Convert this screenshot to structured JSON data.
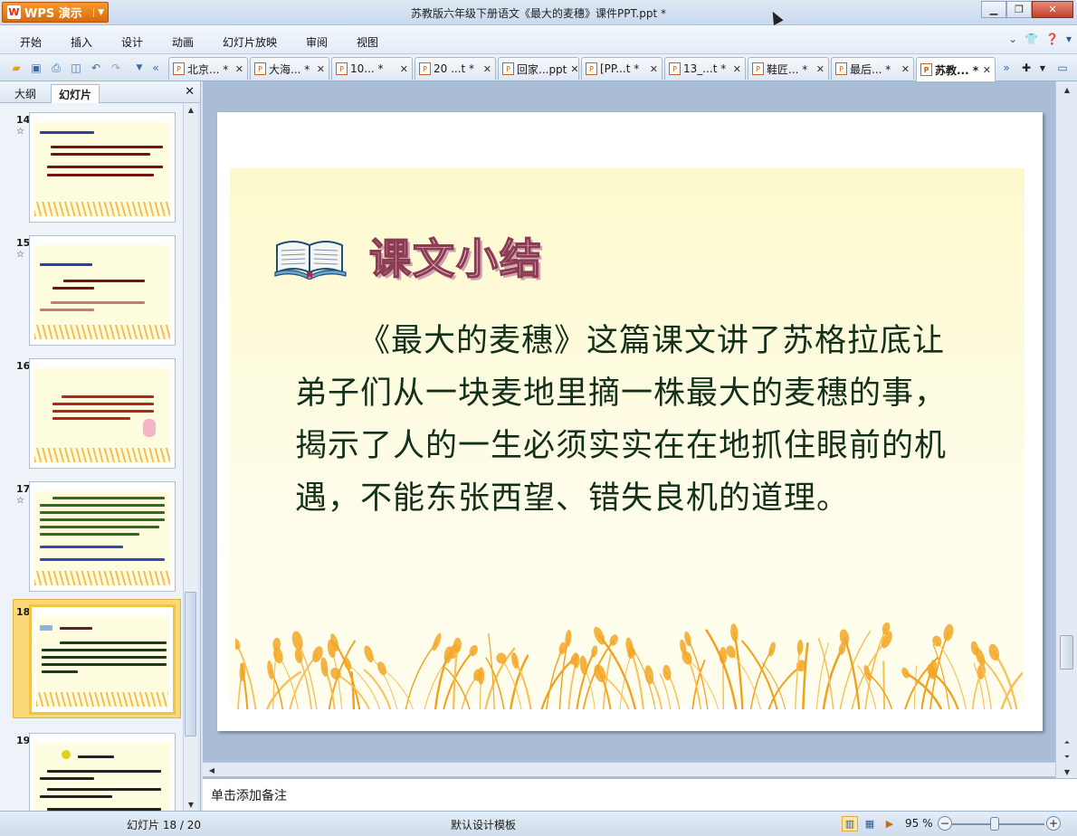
{
  "app": {
    "name": "WPS 演示",
    "window_title": "苏教版六年级下册语文《最大的麦穗》课件PPT.ppt *"
  },
  "menu": [
    "开始",
    "插入",
    "设计",
    "动画",
    "幻灯片放映",
    "审阅",
    "视图"
  ],
  "doc_tabs": [
    {
      "label": "北京... *",
      "active": false
    },
    {
      "label": "大海... *",
      "active": false
    },
    {
      "label": "10... *",
      "active": false
    },
    {
      "label": "20 ...t *",
      "active": false
    },
    {
      "label": "回家...ppt",
      "active": false
    },
    {
      "label": "[PP...t *",
      "active": false
    },
    {
      "label": "13_...t *",
      "active": false
    },
    {
      "label": "鞋匠... *",
      "active": false
    },
    {
      "label": "最后... *",
      "active": false
    },
    {
      "label": "苏教... *",
      "active": true
    }
  ],
  "panel": {
    "tab_outline": "大纲",
    "tab_slides": "幻灯片"
  },
  "thumbnails": [
    {
      "number": "14",
      "star": "☆"
    },
    {
      "number": "15",
      "star": "☆"
    },
    {
      "number": "16",
      "star": ""
    },
    {
      "number": "17",
      "star": "☆"
    },
    {
      "number": "18",
      "star": ""
    },
    {
      "number": "19",
      "star": ""
    }
  ],
  "slide": {
    "heading": "课文小结",
    "body": "《最大的麦穗》这篇课文讲了苏格拉底让弟子们从一块麦地里摘一株最大的麦穗的事，揭示了人的一生必须实实在在地抓住眼前的机遇，不能东张西望、错失良机的道理。"
  },
  "notes": {
    "placeholder": "单击添加备注"
  },
  "status": {
    "slide_indicator": "幻灯片 18 / 20",
    "template": "默认设计模板",
    "zoom": "95 %"
  },
  "colors": {
    "accent_orange": "#e8831f",
    "slide_text": "#12301a",
    "heading_outline": "#8b3b52",
    "selection": "#f2c445"
  }
}
